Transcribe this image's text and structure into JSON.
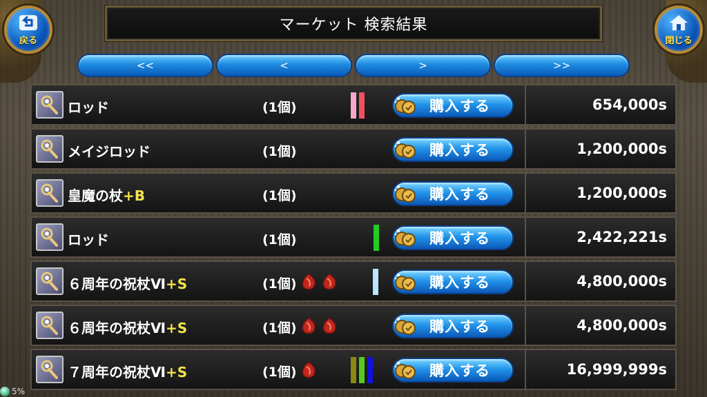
{
  "header": {
    "title": "マーケット 検索結果"
  },
  "nav": {
    "back_label": "戻る",
    "close_label": "閉じる"
  },
  "pager": [
    "<<",
    "<",
    ">",
    ">>"
  ],
  "buy_label": "購入する",
  "rows": [
    {
      "name": "ロッド",
      "grade": "",
      "qty": "(1個)",
      "gems": 0,
      "bars": [
        "#f4a7c8",
        "#f05060"
      ],
      "price": "654,000s"
    },
    {
      "name": "メイジロッド",
      "grade": "",
      "qty": "(1個)",
      "gems": 0,
      "bars": [],
      "price": "1,200,000s"
    },
    {
      "name": "皇魔の杖",
      "grade": "+B",
      "qty": "(1個)",
      "gems": 0,
      "bars": [],
      "price": "1,200,000s"
    },
    {
      "name": "ロッド",
      "grade": "",
      "qty": "(1個)",
      "gems": 0,
      "bars": [
        "#22cc22"
      ],
      "price": "2,422,221s"
    },
    {
      "name": "６周年の祝杖Ⅵ",
      "grade": "+S",
      "qty": "(1個)",
      "gems": 2,
      "bars": [
        "#b8e6ff"
      ],
      "price": "4,800,000s"
    },
    {
      "name": "６周年の祝杖Ⅵ",
      "grade": "+S",
      "qty": "(1個)",
      "gems": 2,
      "bars": [],
      "price": "4,800,000s"
    },
    {
      "name": "７周年の祝杖Ⅵ",
      "grade": "+S",
      "qty": "(1個)",
      "gems": 1,
      "bars": [
        "#8a8a12",
        "#55cc22",
        "#1010e0"
      ],
      "price": "16,999,999s"
    }
  ],
  "status": {
    "percent": "5%"
  }
}
